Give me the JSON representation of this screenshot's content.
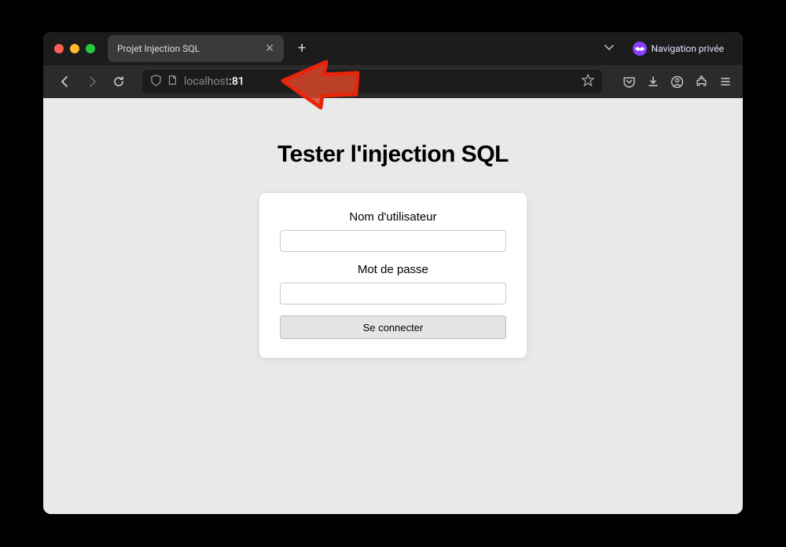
{
  "browser": {
    "tab": {
      "title": "Projet Injection SQL"
    },
    "private_label": "Navigation privée",
    "url": {
      "host": "localhost",
      "port": ":81"
    }
  },
  "page": {
    "title": "Tester l'injection SQL",
    "form": {
      "username_label": "Nom d'utilisateur",
      "username_value": "",
      "password_label": "Mot de passe",
      "password_value": "",
      "submit_label": "Se connecter"
    }
  }
}
